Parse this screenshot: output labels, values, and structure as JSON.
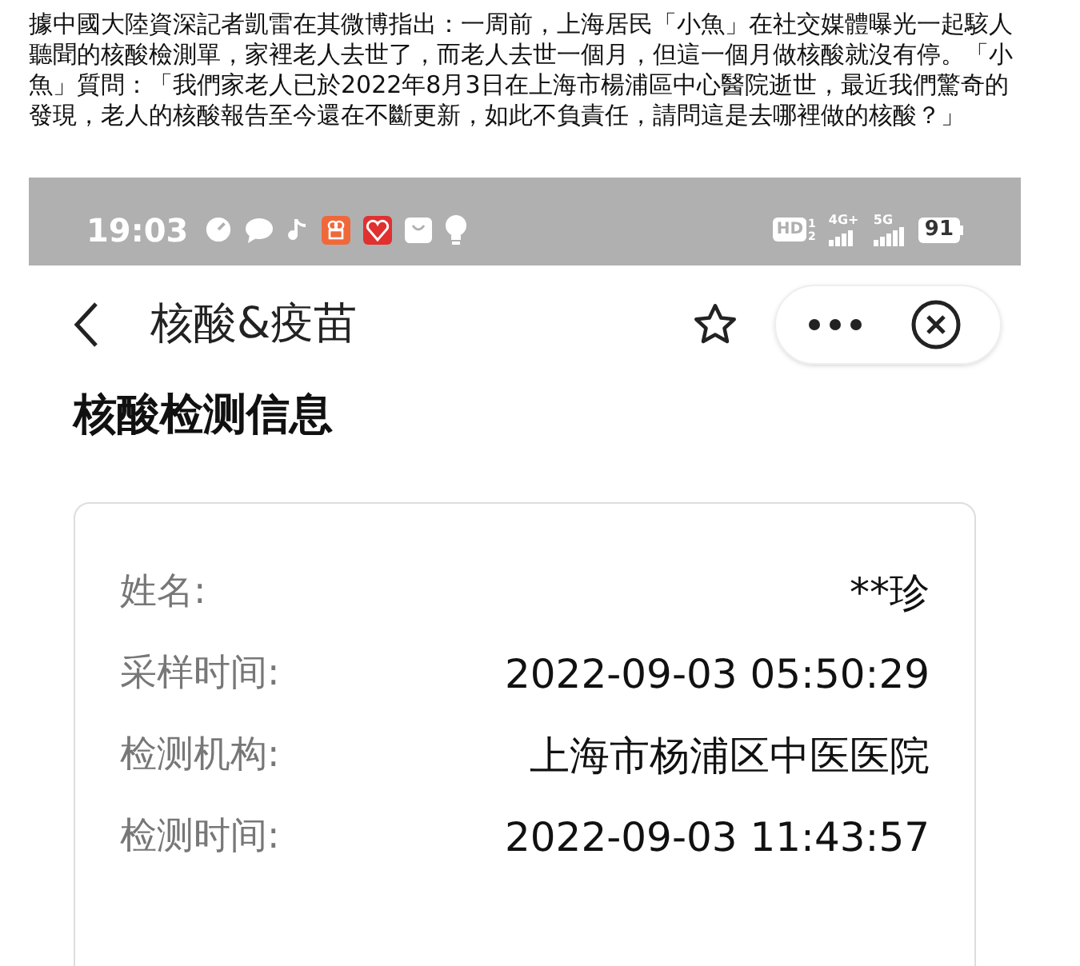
{
  "article": {
    "paragraphs": [
      "據中國大陸資深記者凱雷在其微博指出：一周前，上海居民「小魚」在社交媒體曝光一起駭人聽聞的核酸檢測單，家裡老人去世了，而老人去世一個月，但這一個月做核酸就沒有停。「小魚」質問：「我們家老人已於2022年8月3日在上海市楊浦區中心醫院逝世，最近我們驚奇的發現，老人的核酸報告至今還在不斷更新，如此不負責任，請問這是去哪裡做的核酸？」"
    ]
  },
  "phone": {
    "status_bar": {
      "time": "19:03",
      "hd": "HD",
      "hd_sims": [
        "1",
        "2"
      ],
      "network_1": "4G+",
      "network_2": "5G",
      "battery": "91"
    },
    "nav": {
      "title": "核酸&疫苗"
    },
    "heading": "核酸检测信息",
    "record": [
      {
        "label": "姓名:",
        "value": "**珍"
      },
      {
        "label": "采样时间:",
        "value": "2022-09-03 05:50:29"
      },
      {
        "label": "检测机构:",
        "value": "上海市杨浦区中医医院"
      },
      {
        "label": "检测时间:",
        "value": "2022-09-03 11:43:57"
      }
    ]
  }
}
